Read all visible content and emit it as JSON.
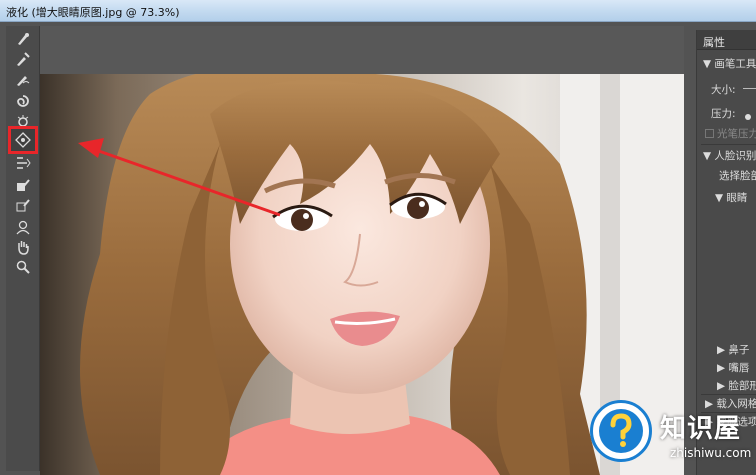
{
  "window": {
    "title": "液化 (增大眼睛原图.jpg @ 73.3%)"
  },
  "tools": [
    {
      "icon": "forward-warp-icon"
    },
    {
      "icon": "reconstruct-icon"
    },
    {
      "icon": "smooth-icon"
    },
    {
      "icon": "twirl-icon"
    },
    {
      "icon": "pucker-icon"
    },
    {
      "icon": "bloat-icon"
    },
    {
      "icon": "push-left-icon"
    },
    {
      "icon": "freeze-mask-icon"
    },
    {
      "icon": "thaw-mask-icon"
    },
    {
      "icon": "face-tool-icon"
    },
    {
      "icon": "hand-icon"
    },
    {
      "icon": "zoom-icon"
    }
  ],
  "highlight_color": "#e8262a",
  "properties": {
    "header": "属性",
    "brush_section": "▼ 画笔工具选",
    "size_label": "大小:",
    "pressure_label": "压力:",
    "stylus_label": "光笔压力",
    "face_section": "▼ 人脸识别液",
    "select_face_label": "选择脸部",
    "eyes_label": "▼ 眼睛",
    "nose_label": "▶ 鼻子",
    "mouth_label": "▶ 嘴唇",
    "face_shape_label": "▶ 脸部形",
    "load_mesh_label": "▶ 载入网格选",
    "mask_label": "▶ 蒙版选项"
  },
  "watermark": {
    "brand": "知识屋",
    "domain": "zhishiwu.com"
  }
}
